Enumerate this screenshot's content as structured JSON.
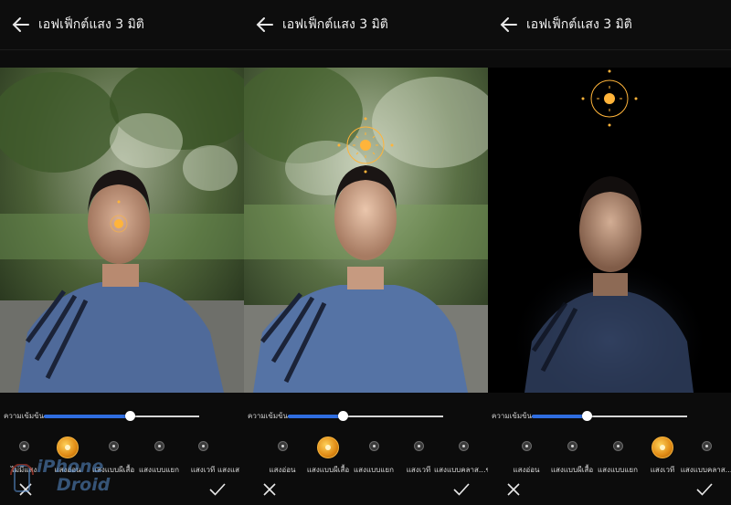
{
  "panels": [
    {
      "title": "เอฟเฟ็กต์แสง 3 มิติ",
      "strength_label": "ความเข้มข้น",
      "strength_value": 0.55,
      "options": [
        {
          "label": "ไม่มีแสง",
          "selected": false
        },
        {
          "label": "แสงอ่อน",
          "selected": true
        },
        {
          "label": "แสงแบบผีเสื้อ",
          "selected": false
        },
        {
          "label": "แสงแบบแยก",
          "selected": false
        },
        {
          "label": "แสงเวที",
          "selected": false
        },
        {
          "label": "แสงแส",
          "selected": false
        }
      ]
    },
    {
      "title": "เอฟเฟ็กต์แสง 3 มิติ",
      "strength_label": "ความเข้มข้น",
      "strength_value": 0.35,
      "options": [
        {
          "label": "แสงอ่อน",
          "selected": false
        },
        {
          "label": "แสงแบบผีเสื้อ",
          "selected": true
        },
        {
          "label": "แสงแบบแยก",
          "selected": false
        },
        {
          "label": "แสงเวที",
          "selected": false
        },
        {
          "label": "แสงแบบคลาส...ขาว",
          "selected": false
        }
      ]
    },
    {
      "title": "เอฟเฟ็กต์แสง 3 มิติ",
      "strength_label": "ความเข้มข้น",
      "strength_value": 0.35,
      "options": [
        {
          "label": "แสงอ่อน",
          "selected": false
        },
        {
          "label": "แสงแบบผีเสื้อ",
          "selected": false
        },
        {
          "label": "แสงแบบแยก",
          "selected": false
        },
        {
          "label": "แสงเวที",
          "selected": true
        },
        {
          "label": "แสงแบบคลาส...",
          "selected": false
        }
      ]
    }
  ],
  "watermark": {
    "line1": "iPhone",
    "line2": "Droid"
  },
  "colors": {
    "accent": "#f0a020",
    "slider": "#2f6de0"
  }
}
